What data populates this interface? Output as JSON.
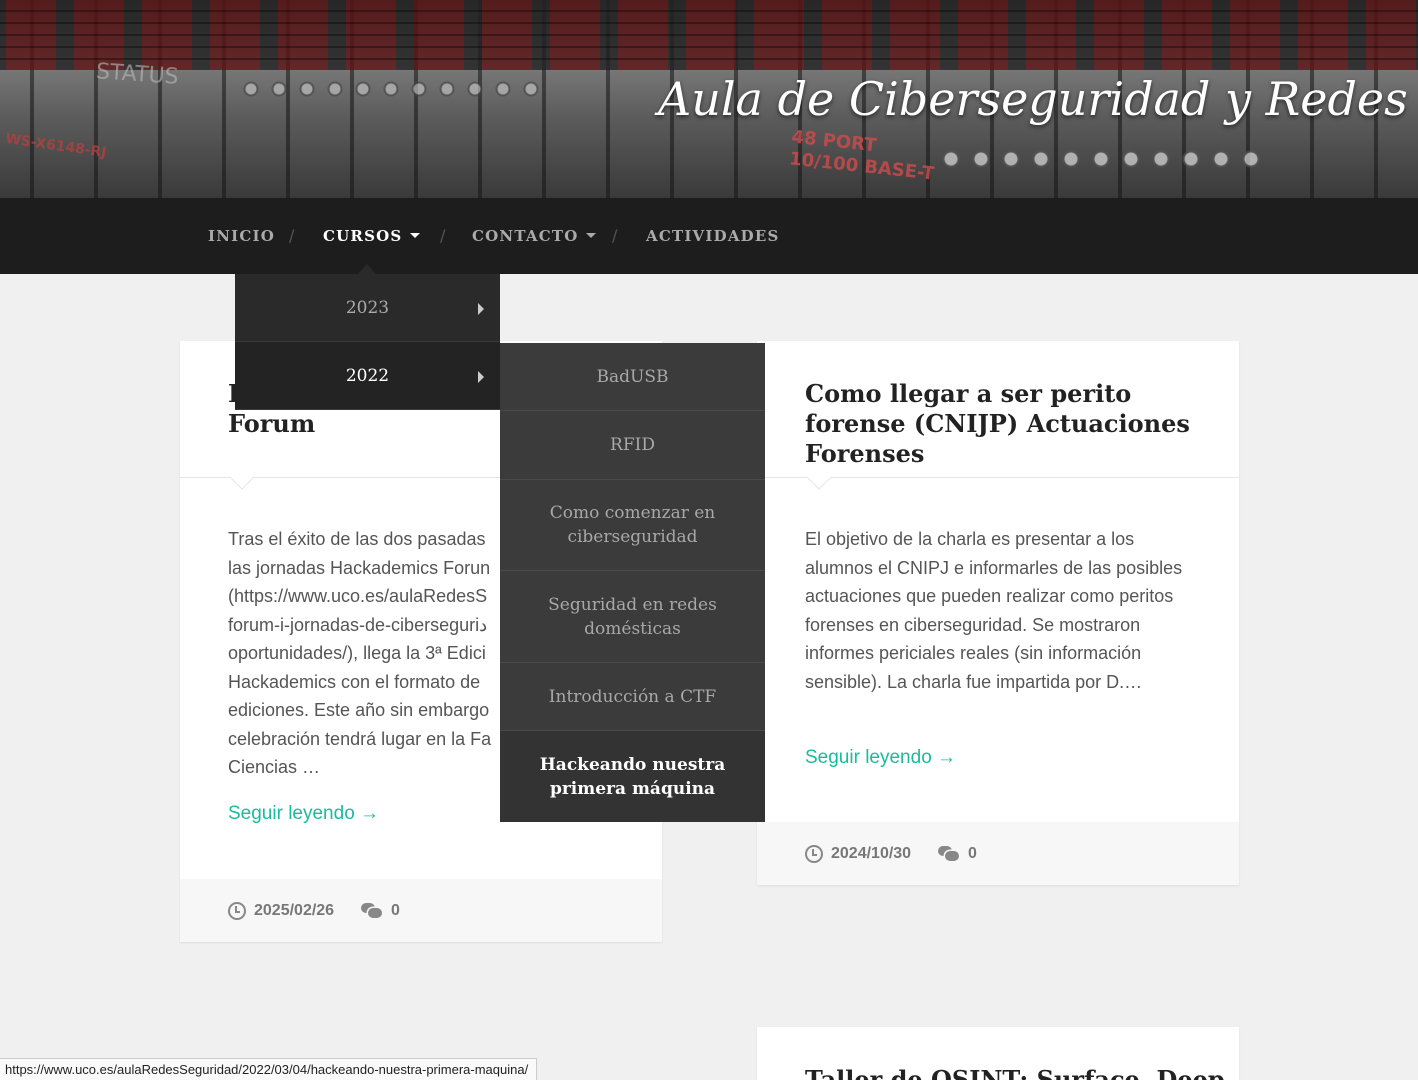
{
  "header": {
    "site_title": "Aula de Ciberseguridad y Redes",
    "banner_text": {
      "status": "STATUS",
      "port_line1": "48 PORT",
      "port_line2": "10/100 BASE-T",
      "model": "WS-X6148-RJ"
    }
  },
  "nav": {
    "items": [
      {
        "label": "INICIO"
      },
      {
        "label": "CURSOS",
        "has_caret": true,
        "active": true
      },
      {
        "label": "CONTACTO",
        "has_caret": true
      },
      {
        "label": "ACTIVIDADES"
      }
    ],
    "separator": "/"
  },
  "dropdown": {
    "items": [
      {
        "label": "2023",
        "has_submenu": true
      },
      {
        "label": "2022",
        "has_submenu": true,
        "hover": true
      }
    ]
  },
  "submenu": {
    "items": [
      {
        "label": "BadUSB"
      },
      {
        "label": "RFID"
      },
      {
        "label": "Como comenzar en ciberseguridad"
      },
      {
        "label": "Seguridad en redes domésticas"
      },
      {
        "label": "Introducción a CTF"
      },
      {
        "label": "Hackeando nuestra primera máquina",
        "hover": true
      }
    ]
  },
  "posts": [
    {
      "title_partial_visible": "I",
      "title_line2": "Forum",
      "excerpt_lines": [
        "Tras el éxito de las dos pasadas",
        "las jornadas Hackademics Forun",
        "(https://www.uco.es/aulaRedesS",
        "forum-i-jornadas-de-ciberseguriد",
        "oportunidades/), llega la 3ª Edici",
        "Hackademics con el formato de",
        "ediciones. Este año sin embargo",
        "celebración tendrá lugar en la Fa",
        "Ciencias …"
      ],
      "read_more": "Seguir leyendo →",
      "date": "2025/02/26",
      "comments": "0"
    },
    {
      "title": "Como llegar a ser perito forense (CNIJP) Actuaciones Forenses",
      "excerpt": "El objetivo de la charla es presentar a los alumnos el CNIPJ e informarles de las posibles actuaciones que pueden realizar como peritos forenses en ciberseguridad. Se mostraron informes periciales reales (sin información sensible). La charla fue impartida por D.…",
      "read_more": "Seguir leyendo →",
      "date": "2024/10/30",
      "comments": "0"
    },
    {
      "title": "Taller de OSINT: Surface, Deep"
    }
  ],
  "status_bar": {
    "url": "https://www.uco.es/aulaRedesSeguridad/2022/03/04/hackeando-nuestra-primera-maquina/"
  },
  "colors": {
    "nav_background": "#1d1d1d",
    "dropdown_background": "#2a2a2a",
    "submenu_background": "#3b3b3b",
    "link_accent": "#1abc9c",
    "page_background": "#f0f0f0"
  }
}
